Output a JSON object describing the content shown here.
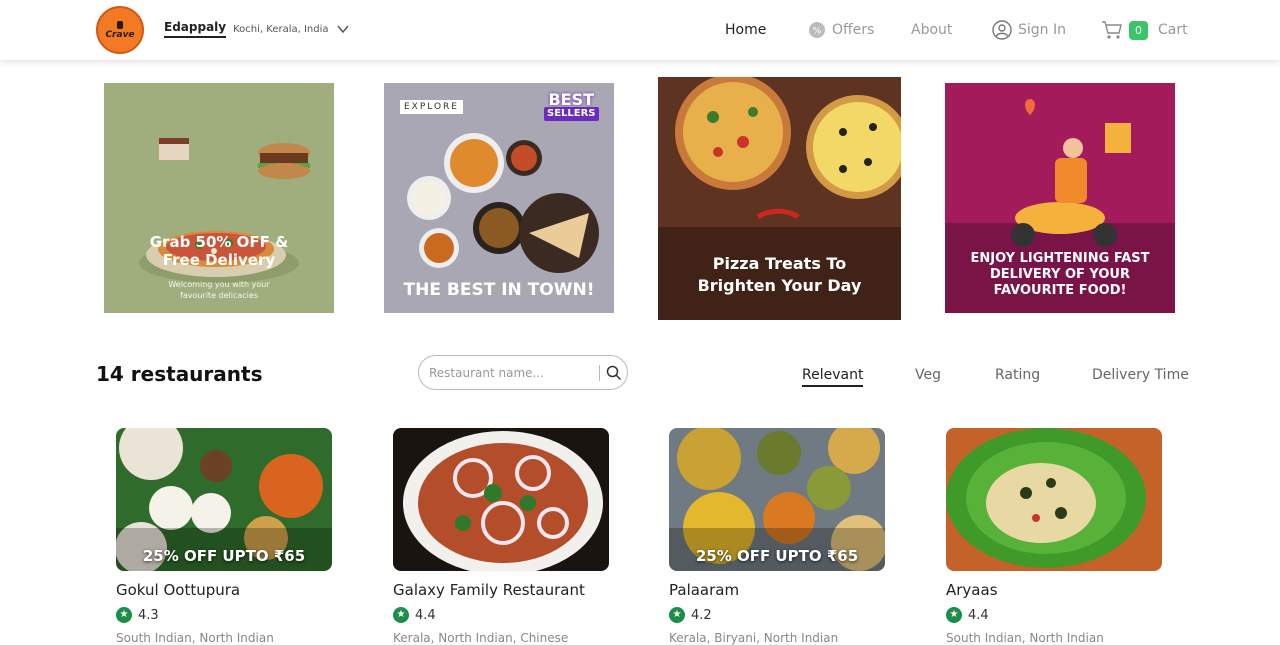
{
  "header": {
    "logo_text": "Crave",
    "location_city": "Edappaly",
    "location_region": "Kochi, Kerala, India",
    "nav": {
      "home": "Home",
      "offers": "Offers",
      "about": "About",
      "signin": "Sign In",
      "cart": "Cart",
      "cart_count": "0"
    }
  },
  "banners": [
    {
      "headline": "Grab 50% OFF & Free Delivery",
      "sub": "Welcoming you with your favourite delicacies"
    },
    {
      "tag": "EXPLORE",
      "badge_top": "BEST",
      "badge_bottom": "SELLERS",
      "headline": "THE BEST IN TOWN!"
    },
    {
      "headline": "Pizza Treats To Brighten Your Day"
    },
    {
      "headline": "ENJOY LIGHTENING FAST DELIVERY OF YOUR FAVOURITE FOOD!"
    }
  ],
  "listing": {
    "count_title": "14 restaurants",
    "search_placeholder": "Restaurant name...",
    "filters": [
      "Relevant",
      "Veg",
      "Rating",
      "Delivery Time"
    ]
  },
  "restaurants": [
    {
      "name": "Gokul Oottupura",
      "rating": "4.3",
      "cuisine": "South Indian, North Indian",
      "offer": "25% OFF UPTO ₹65"
    },
    {
      "name": "Galaxy Family Restaurant",
      "rating": "4.4",
      "cuisine": "Kerala, North Indian, Chinese",
      "offer": ""
    },
    {
      "name": "Palaaram",
      "rating": "4.2",
      "cuisine": "Kerala, Biryani, North Indian",
      "offer": "25% OFF UPTO ₹65"
    },
    {
      "name": "Aryaas",
      "rating": "4.4",
      "cuisine": "South Indian, North Indian",
      "offer": ""
    }
  ],
  "colors": {
    "brand": "#f27a24",
    "cart_badge": "#3bc46b",
    "rating_star": "#1b8f4a"
  }
}
